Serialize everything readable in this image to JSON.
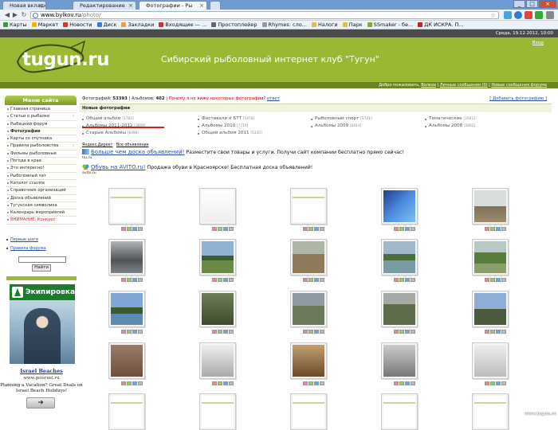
{
  "browser": {
    "tabs": [
      {
        "label": "Новая вкладка",
        "active": false
      },
      {
        "label": "Редактирование",
        "active": false
      },
      {
        "label": "Фотографии - Ры",
        "active": true
      },
      {
        "label": "",
        "active": false
      }
    ],
    "url_host": "www.bylkov.ru",
    "url_path": "/photo/",
    "bookmarks": [
      {
        "label": "Карты",
        "color": "#3a9a3a"
      },
      {
        "label": "Маркет",
        "color": "#f5b400"
      },
      {
        "label": "Новости",
        "color": "#d33"
      },
      {
        "label": "Диск",
        "color": "#3a7be0"
      },
      {
        "label": "Закладки",
        "color": "#e8a33a"
      },
      {
        "label": "Входящие — ...",
        "color": "#cc3333"
      },
      {
        "label": "Простоплейер",
        "color": "#666"
      },
      {
        "label": "Rhymes: сло...",
        "color": "#999"
      },
      {
        "label": "Налоги",
        "color": "#e0c040"
      },
      {
        "label": "Парк",
        "color": "#e0c040"
      },
      {
        "label": "SSmaker - бе...",
        "color": "#8a3"
      },
      {
        "label": "ДК ИСКРА. П...",
        "color": "#c22"
      }
    ]
  },
  "top_strip_date": "Среда, 19.12.2012, 10:00",
  "header": {
    "logo_text": "tugun",
    "logo_suffix": ".ru",
    "title": "Сибирский рыболовный интернет клуб \"Тугун\"",
    "top_link": "Вход",
    "welcome": "Добро пожаловать,",
    "user": "Волков",
    "pm": "Личные сообщения (0)",
    "forum_new": "Новые сообщения форума"
  },
  "sidebar": {
    "menu_title": "Меню сайта",
    "items": [
      {
        "label": "Главная страница",
        "bold": false,
        "red": false,
        "arrow": false
      },
      {
        "label": "Статьи о рыбалке",
        "bold": false,
        "red": false,
        "arrow": true
      },
      {
        "label": "Рыбацкий форум",
        "bold": false,
        "red": false,
        "arrow": false
      },
      {
        "label": "Фотографии",
        "bold": true,
        "red": false,
        "arrow": false
      },
      {
        "label": "Карты со спутника",
        "bold": false,
        "red": false,
        "arrow": false
      },
      {
        "label": "Правила рыболовства",
        "bold": false,
        "red": false,
        "arrow": true
      },
      {
        "label": "Фильмы рыболовные",
        "bold": false,
        "red": false,
        "arrow": false
      },
      {
        "label": "Погода в крае",
        "bold": false,
        "red": false,
        "arrow": false
      },
      {
        "label": "Это интересно!",
        "bold": false,
        "red": false,
        "arrow": false
      },
      {
        "label": "Рыболовный чат",
        "bold": false,
        "red": false,
        "arrow": false
      },
      {
        "label": "Каталог ссылок",
        "bold": false,
        "red": false,
        "arrow": false
      },
      {
        "label": "Справочник организаций",
        "bold": false,
        "red": false,
        "arrow": false
      },
      {
        "label": "Доска объявлений",
        "bold": false,
        "red": false,
        "arrow": false
      },
      {
        "label": "Тугунская символика",
        "bold": false,
        "red": false,
        "arrow": false
      },
      {
        "label": "Календарь мероприятий",
        "bold": false,
        "red": false,
        "arrow": false
      },
      {
        "label": "ВНИМАНИЕ: Конкурс",
        "bold": false,
        "red": true,
        "arrow": false
      }
    ],
    "links": [
      "Первые шаги",
      "Правила форума"
    ],
    "search_button": "Найти",
    "ad_title": "Экипировка"
  },
  "israel_ad": {
    "title": "Israel Beaches",
    "url": "www.goisrael.ru",
    "body": "Planning a Vacation? Great Deals on Israel Beach Holidays!",
    "button": "➜"
  },
  "main": {
    "photos_label": "Фотографий:",
    "photos_count": "53393",
    "albums_label": "Альбомов:",
    "albums_count": "402",
    "warning": "Почему я не вижу некоторые фотографии?",
    "answer": "ответ",
    "add_photo": "Добавить фотографию",
    "new_photos": "Новые фотографии",
    "albums": [
      {
        "name": "Общий альбом",
        "count": "[1742]"
      },
      {
        "name": "Фестивали и БТТ",
        "count": "[5474]"
      },
      {
        "name": "Рыболовный спорт",
        "count": "[3721]"
      },
      {
        "name": "Тематические",
        "count": "[2562]"
      },
      {
        "name": "Альбомы 2011-2012",
        "count": "[3669]"
      },
      {
        "name": "Альбомы 2010",
        "count": "[7719]"
      },
      {
        "name": "Альбомы 2009",
        "count": "[6414]"
      },
      {
        "name": "Альбомы 2008",
        "count": "[5062]"
      },
      {
        "name": "Старые Альбомы",
        "count": "[6496]"
      },
      {
        "name": "Общий альбом 2011",
        "count": "[5335]"
      }
    ],
    "direct_yandex": "Яндекс.Директ",
    "all_ads": "Все объявления",
    "ad1_link": "Больше чем доска объявлений!",
    "ad1_text": "Разместите свои товары и услуги. Получи сайт компании бесплатно прямо сейчас!",
    "ad1_site": "tiu.ru",
    "ad2_link": "Обувь на AVITO.ru!",
    "ad2_text": "Продажа обуви в Красноярске! Бесплатная доска объявлений!",
    "ad2_site": "avito.ru"
  },
  "watermark": "www.tugun.ru"
}
